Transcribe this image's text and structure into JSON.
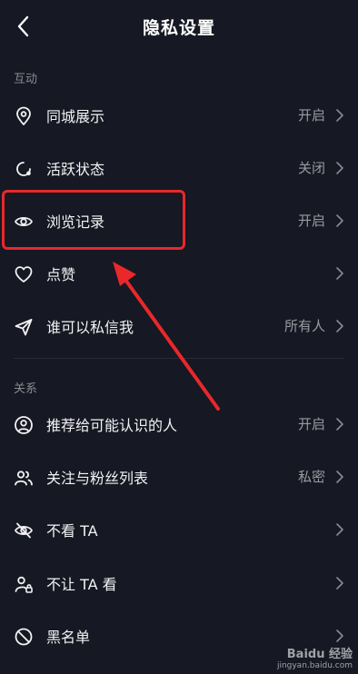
{
  "header": {
    "title": "隐私设置"
  },
  "sections": {
    "interaction": "互动",
    "relations": "关系"
  },
  "rows": [
    {
      "label": "同城展示",
      "value": "开启"
    },
    {
      "label": "活跃状态",
      "value": "关闭"
    },
    {
      "label": "浏览记录",
      "value": "开启"
    },
    {
      "label": "点赞",
      "value": ""
    },
    {
      "label": "谁可以私信我",
      "value": "所有人"
    },
    {
      "label": "推荐给可能认识的人",
      "value": "开启"
    },
    {
      "label": "关注与粉丝列表",
      "value": "私密"
    },
    {
      "label": "不看 TA",
      "value": ""
    },
    {
      "label": "不让 TA 看",
      "value": ""
    },
    {
      "label": "黑名单",
      "value": ""
    }
  ],
  "icons": [
    "back-arrow-icon",
    "location-pin-icon",
    "active-status-icon",
    "eye-icon",
    "heart-icon",
    "send-icon",
    "user-circle-icon",
    "users-icon",
    "eye-off-icon",
    "user-lock-icon",
    "block-icon",
    "chevron-right-icon"
  ],
  "colors": {
    "background": "#161823",
    "highlight": "#e8282a",
    "muted": "#9a9ba0"
  },
  "watermark": {
    "brand": "Baidu 经验",
    "url": "jingyan.baidu.com"
  }
}
